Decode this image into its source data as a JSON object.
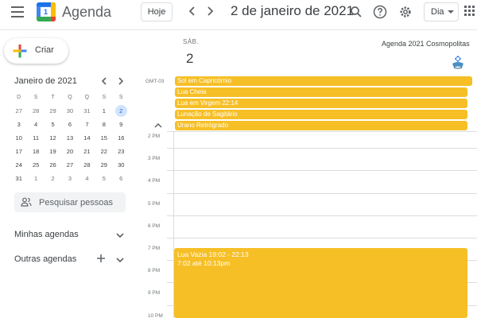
{
  "header": {
    "app_title": "Agenda",
    "logo_text": "1",
    "today_label": "Hoje",
    "date_title": "2 de janeiro de 2021",
    "view_label": "Dia",
    "icons": [
      "menu-icon",
      "search-icon",
      "help-icon",
      "settings-icon",
      "apps-icon"
    ]
  },
  "sidebar": {
    "create_label": "Criar",
    "mini_calendar": {
      "title": "Janeiro de 2021",
      "weekdays": [
        "D",
        "S",
        "T",
        "Q",
        "Q",
        "S",
        "S"
      ],
      "weeks": [
        [
          "27",
          "28",
          "29",
          "30",
          "31",
          "1",
          "2"
        ],
        [
          "3",
          "4",
          "5",
          "6",
          "7",
          "8",
          "9"
        ],
        [
          "10",
          "11",
          "12",
          "13",
          "14",
          "15",
          "16"
        ],
        [
          "17",
          "18",
          "19",
          "20",
          "21",
          "22",
          "23"
        ],
        [
          "24",
          "25",
          "26",
          "27",
          "28",
          "29",
          "30"
        ],
        [
          "31",
          "1",
          "2",
          "3",
          "4",
          "5",
          "6"
        ]
      ],
      "selected_day": "2"
    },
    "search_people_placeholder": "Pesquisar pessoas",
    "my_calendars_label": "Minhas agendas",
    "other_calendars_label": "Outras agendas"
  },
  "day_view": {
    "weekday_abbr": "SÁB.",
    "day_number": "2",
    "calendar_name": "Agenda 2021 Cosmopolitas",
    "timezone_label": "GMT-03",
    "event_color": "#f6bf26",
    "all_day_events": [
      "Sol em Capricórnio",
      "Lua Cheia",
      "Lua em Virgem 22:14",
      "Lunação de Sagitário",
      "Urano Retrógrado"
    ],
    "hours": [
      "2 PM",
      "3 PM",
      "4 PM",
      "5 PM",
      "6 PM",
      "7 PM",
      "8 PM",
      "9 PM",
      "10 PM"
    ],
    "timed_event": {
      "title": "Lua Vazia 19:02 - 22:13",
      "time": "7:02 até 10:13pm"
    }
  }
}
